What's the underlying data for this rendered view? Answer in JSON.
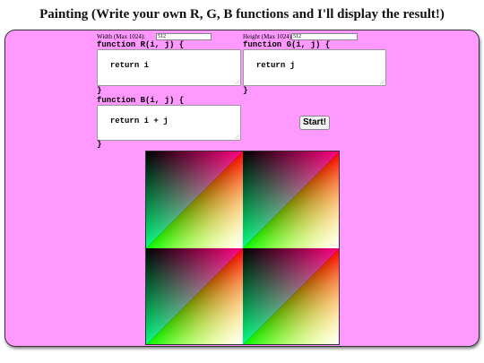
{
  "page": {
    "title": "Painting (Write your own R, G, B functions and I'll display the result!)"
  },
  "dimensions": {
    "width_label": "Width (Max 1024):",
    "width_value": "512",
    "height_label": "Height (Max 1024):",
    "height_value": "512"
  },
  "functions": {
    "r_header": "function R(i, j) {",
    "r_body": "return i",
    "r_close": "}",
    "g_header": "function G(i, j) {",
    "g_body": "return j",
    "g_close": "}",
    "b_header": "function B(i, j) {",
    "b_body": "return i + j",
    "b_close": "}"
  },
  "controls": {
    "start_label": "Start!"
  },
  "colors": {
    "panel_background": "#ff99ff",
    "page_background": "#ffffff"
  }
}
